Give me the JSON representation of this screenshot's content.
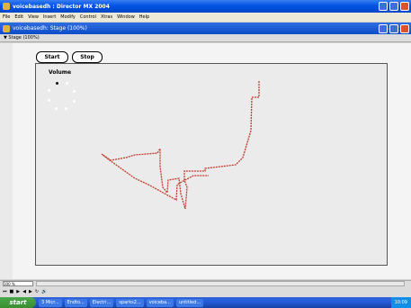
{
  "window": {
    "title": "voicebasedh : Director MX 2004"
  },
  "menu": [
    "File",
    "Edit",
    "View",
    "Insert",
    "Modify",
    "Control",
    "Xtras",
    "Window",
    "Help"
  ],
  "document": {
    "title": "voicebasedh: Stage (100%)"
  },
  "stage_bar": {
    "label": "▼ Stage (100%)"
  },
  "buttons": {
    "start": "Start",
    "stop": "Stop"
  },
  "volume": {
    "label": "Volume",
    "level_dots": 8,
    "active_dots": 1
  },
  "stroke": {
    "color": "#c0392b"
  },
  "bottom": {
    "zoom": "100 %"
  },
  "taskbar": {
    "start": "start",
    "items": [
      "3 Micr...",
      "Endto...",
      "Electri...",
      "sparks2...",
      "voiceba...",
      "untitled..."
    ],
    "clock": "10:09"
  }
}
